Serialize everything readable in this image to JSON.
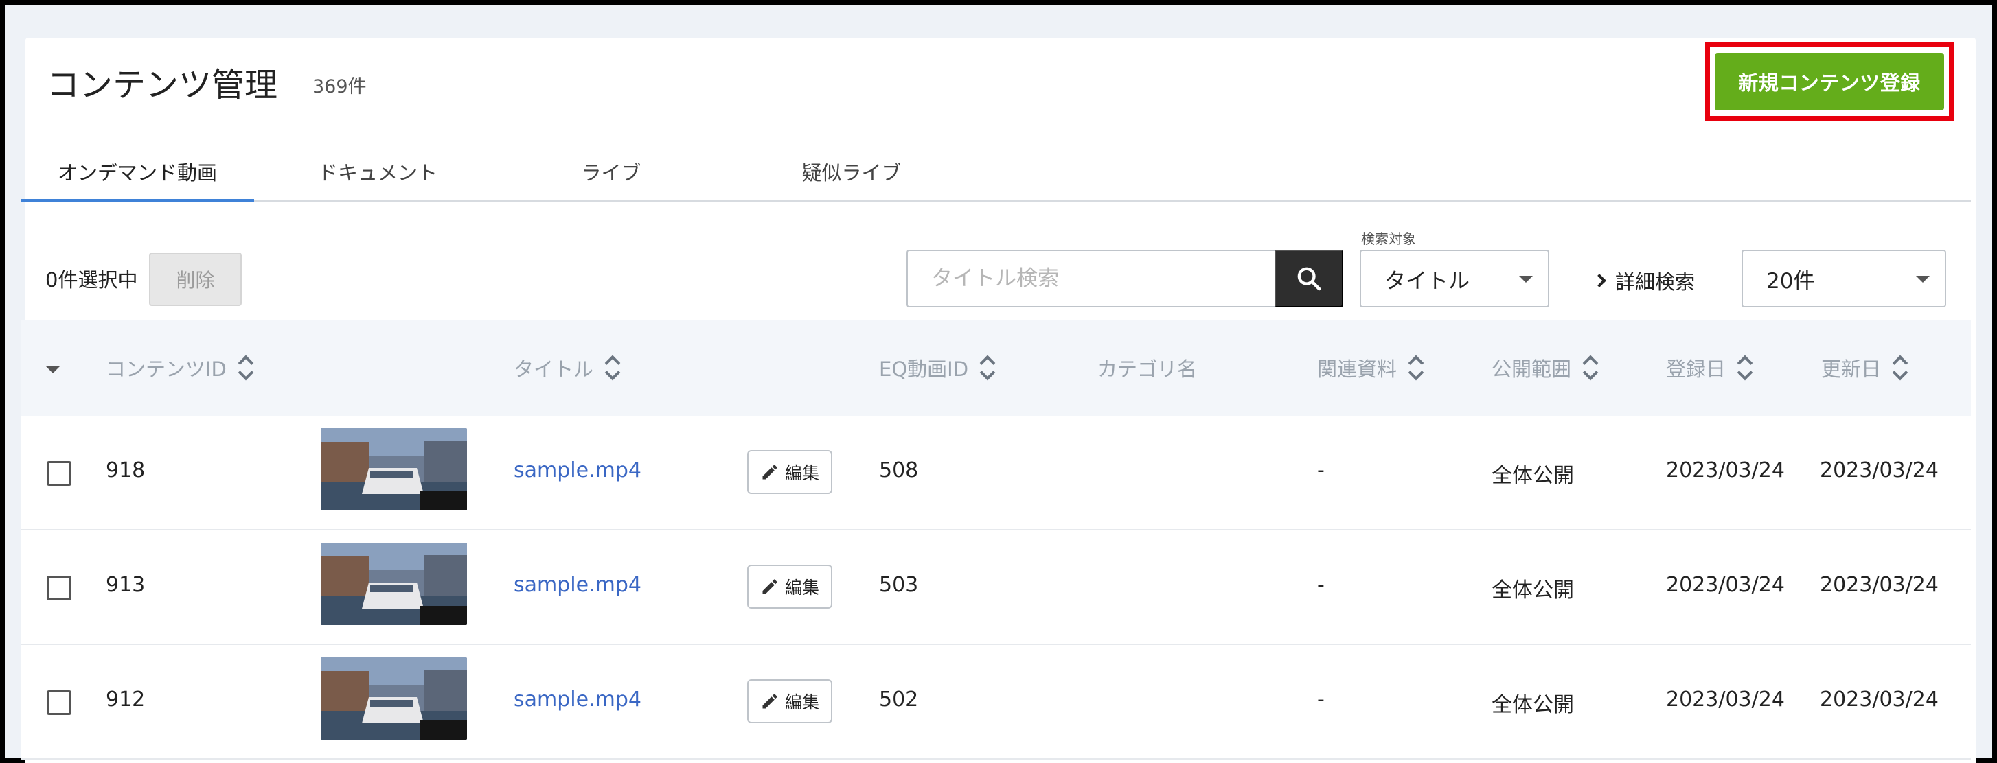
{
  "header": {
    "title": "コンテンツ管理",
    "count": "369件",
    "new_button_label": "新規コンテンツ登録"
  },
  "tabs": [
    {
      "label": "オンデマンド動画",
      "active": true
    },
    {
      "label": "ドキュメント",
      "active": false
    },
    {
      "label": "ライブ",
      "active": false
    },
    {
      "label": "疑似ライブ",
      "active": false
    }
  ],
  "toolbar": {
    "selected_count": "0件選択中",
    "delete_label": "削除",
    "search_placeholder": "タイトル検索",
    "search_target_label": "検索対象",
    "search_target_value": "タイトル",
    "advanced_search_label": "詳細検索",
    "per_page_value": "20件"
  },
  "table": {
    "columns": {
      "content_id": "コンテンツID",
      "title": "タイトル",
      "eq_video_id": "EQ動画ID",
      "category": "カテゴリ名",
      "related": "関連資料",
      "visibility": "公開範囲",
      "registered": "登録日",
      "updated": "更新日"
    },
    "edit_label": "編集",
    "rows": [
      {
        "content_id": "918",
        "title": "sample.mp4",
        "eq_video_id": "508",
        "category": "",
        "related": "-",
        "visibility": "全体公開",
        "registered": "2023/03/24",
        "updated": "2023/03/24"
      },
      {
        "content_id": "913",
        "title": "sample.mp4",
        "eq_video_id": "503",
        "category": "",
        "related": "-",
        "visibility": "全体公開",
        "registered": "2023/03/24",
        "updated": "2023/03/24"
      },
      {
        "content_id": "912",
        "title": "sample.mp4",
        "eq_video_id": "502",
        "category": "",
        "related": "-",
        "visibility": "全体公開",
        "registered": "2023/03/24",
        "updated": "2023/03/24"
      }
    ]
  },
  "colors": {
    "accent_green": "#64ad1b",
    "highlight_red": "#e8000e",
    "link_blue": "#3a67c4",
    "tab_underline": "#3f82d8"
  }
}
